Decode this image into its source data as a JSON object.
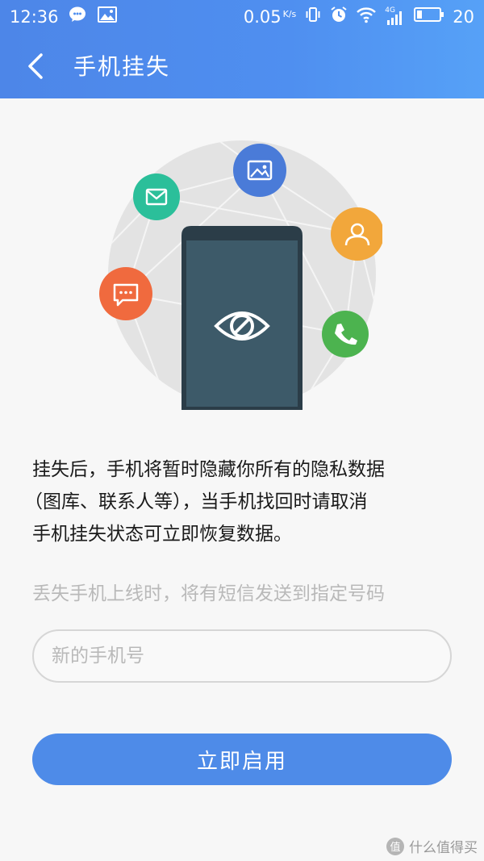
{
  "status_bar": {
    "time": "12:36",
    "speed": "0.05",
    "speed_unit": "K/s",
    "network": "4G",
    "battery": "20",
    "icons": [
      "wechat-icon",
      "gallery-icon",
      "vibrate-icon",
      "alarm-icon",
      "wifi-icon",
      "signal-icon",
      "battery-icon"
    ]
  },
  "nav": {
    "title": "手机挂失",
    "back_icon": "chevron-left-icon"
  },
  "illustration": {
    "icons": [
      "image-icon",
      "mail-icon",
      "contact-icon",
      "message-icon",
      "phone-call-icon",
      "eye-slash-icon"
    ],
    "colors": {
      "image": "#4a7bd8",
      "mail": "#2bbf9a",
      "contact": "#f2a73b",
      "message": "#f06a3e",
      "phone": "#4cb34f",
      "device": "#3a5564",
      "globe": "#e3e3e3"
    }
  },
  "description": {
    "line1": "挂失后，手机将暂时隐藏你所有的隐私数据",
    "line2": "（图库、联系人等），当手机找回时请取消",
    "line3": "手机挂失状态可立即恢复数据。"
  },
  "hint": "丢失手机上线时，将有短信发送到指定号码",
  "phone_input": {
    "value": "",
    "placeholder": "新的手机号"
  },
  "enable_button": {
    "label": "立即启用"
  },
  "watermark": {
    "badge": "值",
    "text": "什么值得买"
  },
  "colors": {
    "header": "#4f8ff0",
    "button": "#4e8be8",
    "background": "#f7f7f7"
  }
}
